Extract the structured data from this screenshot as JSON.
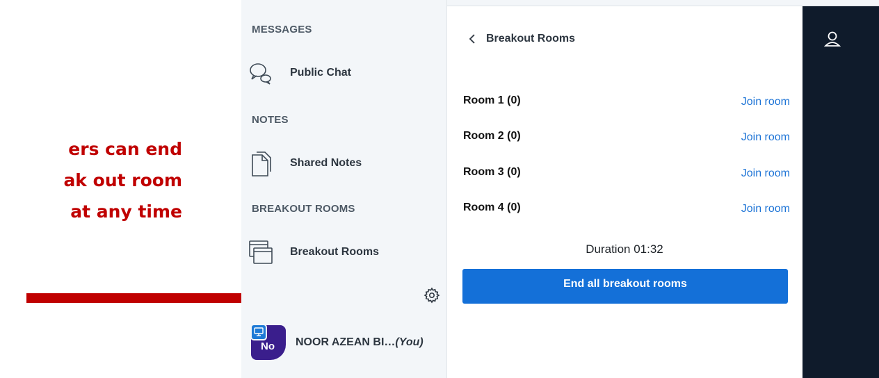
{
  "annotation": {
    "lines": [
      "ers can end",
      "ak out room",
      "at any time"
    ],
    "color": "#c00000"
  },
  "sidebar": {
    "messages_title": "MESSAGES",
    "public_chat": "Public Chat",
    "notes_title": "NOTES",
    "shared_notes": "Shared Notes",
    "breakout_title": "BREAKOUT ROOMS",
    "breakout_item": "Breakout Rooms",
    "user_initials": "No",
    "user_name": "NOOR AZEAN BI…",
    "user_you": "(You)"
  },
  "panel": {
    "back_label": "Breakout Rooms",
    "rooms": [
      {
        "name": "Room 1 (0)",
        "action": "Join room"
      },
      {
        "name": "Room 2 (0)",
        "action": "Join room"
      },
      {
        "name": "Room 3 (0)",
        "action": "Join room"
      },
      {
        "name": "Room 4 (0)",
        "action": "Join room"
      }
    ],
    "duration": "Duration 01:32",
    "end_button": "End all breakout rooms"
  },
  "colors": {
    "accent": "#1470d8",
    "link": "#1c73d6",
    "darkbar": "#0f1b2b",
    "avatar": "#3a1e8c"
  },
  "icons": [
    "chat-bubbles-icon",
    "document-icon",
    "windows-icon",
    "gear-icon",
    "presenter-icon",
    "chevron-left-icon",
    "user-icon"
  ]
}
